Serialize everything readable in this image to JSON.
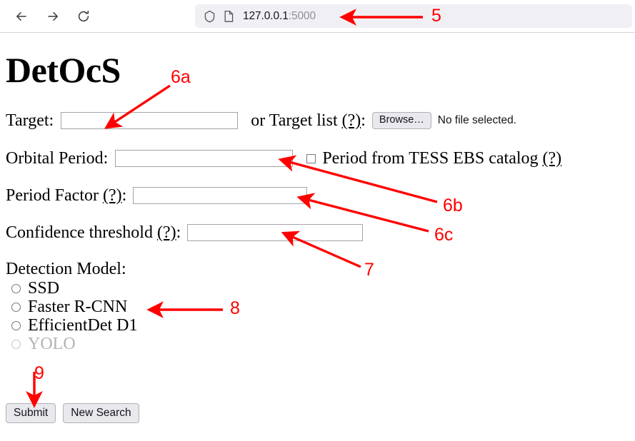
{
  "browser": {
    "back_icon": "arrow-left-icon",
    "forward_icon": "arrow-right-icon",
    "reload_icon": "reload-icon",
    "shield_icon": "shield-icon",
    "page_icon": "page-document-icon",
    "url_host": "127.0.0.1",
    "url_port": ":5000"
  },
  "page": {
    "title": "DetOcS",
    "target": {
      "label": "Target:",
      "input_value": "",
      "input_placeholder": ""
    },
    "target_list": {
      "label_prefix": "or Target list ",
      "help": "(?)",
      "label_suffix": ":",
      "browse_label": "Browse…",
      "file_status": "No file selected."
    },
    "orbital_period": {
      "label": "Orbital Period:",
      "input_value": "",
      "checkbox_checked": false,
      "checkbox_label_prefix": "Period from TESS EBS catalog ",
      "checkbox_help": "(?)"
    },
    "period_factor": {
      "label_prefix": "Period Factor ",
      "help": "(?)",
      "label_suffix": ":",
      "input_value": ""
    },
    "confidence_threshold": {
      "label_prefix": "Confidence threshold ",
      "help": "(?)",
      "label_suffix": ":",
      "input_value": ""
    },
    "detection_model": {
      "heading": "Detection Model:",
      "options": [
        {
          "label": "SSD",
          "selected": false,
          "disabled": false
        },
        {
          "label": "Faster R-CNN",
          "selected": false,
          "disabled": false
        },
        {
          "label": "EfficientDet D1",
          "selected": false,
          "disabled": false
        },
        {
          "label": "YOLO",
          "selected": false,
          "disabled": true
        }
      ]
    },
    "buttons": {
      "submit_label": "Submit",
      "new_search_label": "New Search"
    }
  },
  "annotations": {
    "color": "#ff0000",
    "markers": [
      {
        "id": "5",
        "label": "5"
      },
      {
        "id": "6a",
        "label": "6a"
      },
      {
        "id": "6b",
        "label": "6b"
      },
      {
        "id": "6c",
        "label": "6c"
      },
      {
        "id": "7",
        "label": "7"
      },
      {
        "id": "8",
        "label": "8"
      },
      {
        "id": "9",
        "label": "9"
      }
    ]
  }
}
